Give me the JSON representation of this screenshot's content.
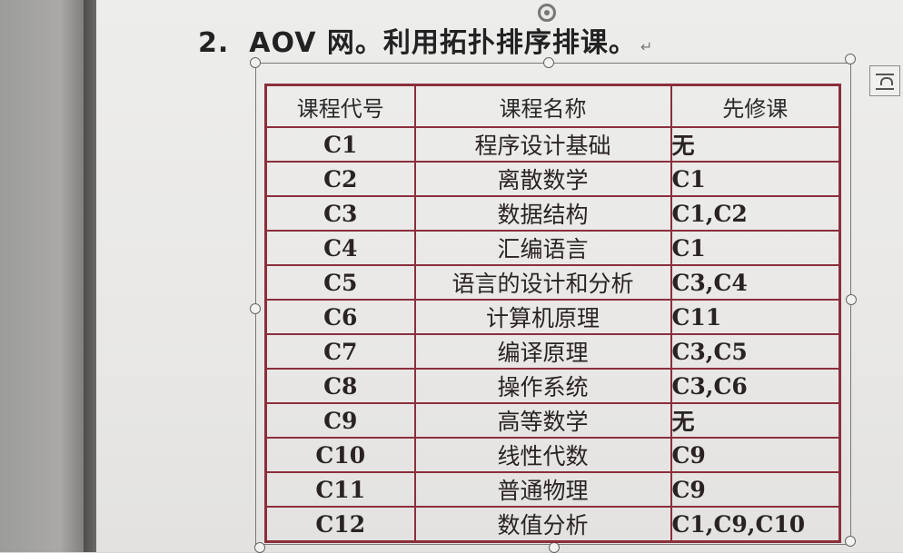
{
  "heading": {
    "number": "2.",
    "text": "AOV 网。利用拓扑排序排课。",
    "return_mark": "↵"
  },
  "table": {
    "headers": [
      "课程代号",
      "课程名称",
      "先修课"
    ],
    "rows": [
      {
        "code": "C1",
        "name": "程序设计基础",
        "prereq": "无"
      },
      {
        "code": "C2",
        "name": "离散数学",
        "prereq": "C1"
      },
      {
        "code": "C3",
        "name": "数据结构",
        "prereq": "C1,C2"
      },
      {
        "code": "C4",
        "name": "汇编语言",
        "prereq": "C1"
      },
      {
        "code": "C5",
        "name": "语言的设计和分析",
        "prereq": "C3,C4"
      },
      {
        "code": "C6",
        "name": "计算机原理",
        "prereq": "C11"
      },
      {
        "code": "C7",
        "name": "编译原理",
        "prereq": "C3,C5"
      },
      {
        "code": "C8",
        "name": "操作系统",
        "prereq": "C3,C6"
      },
      {
        "code": "C9",
        "name": "高等数学",
        "prereq": "无"
      },
      {
        "code": "C10",
        "name": "线性代数",
        "prereq": "C9"
      },
      {
        "code": "C11",
        "name": "普通物理",
        "prereq": "C9"
      },
      {
        "code": "C12",
        "name": "数值分析",
        "prereq": "C1,C9,C10"
      }
    ]
  },
  "colors": {
    "table_border": "#8b2f3c",
    "page_background": "#ececea"
  },
  "icons": {
    "rotate": "rotate-handle-icon",
    "layout_options": "layout-options-icon"
  }
}
